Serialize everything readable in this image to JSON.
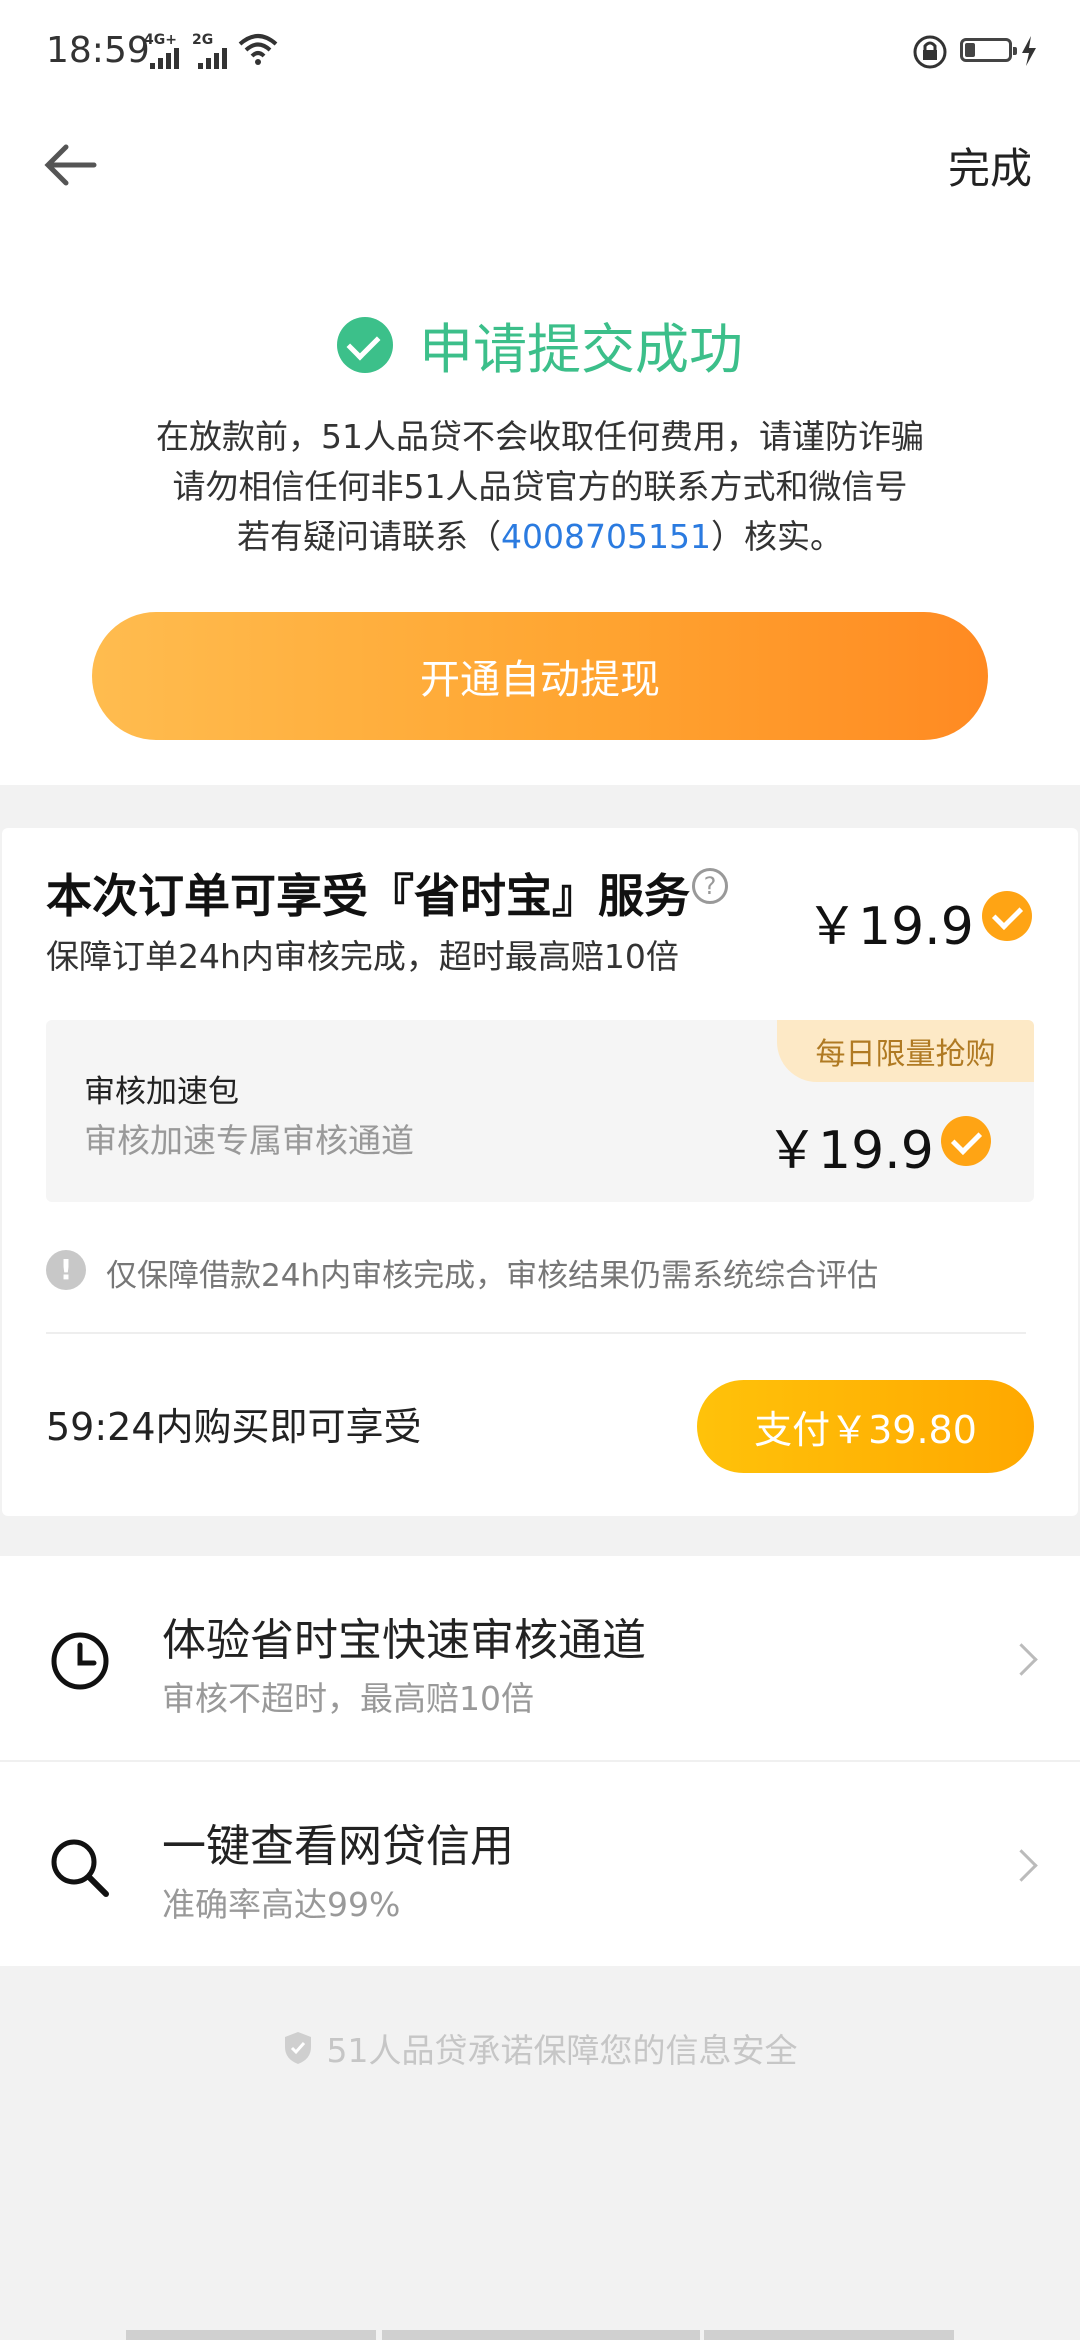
{
  "status_bar": {
    "time": "18:59",
    "net1": "4G+",
    "net2": "2G"
  },
  "header": {
    "done_label": "完成"
  },
  "success": {
    "title": "申请提交成功",
    "notice_line1": "在放款前，51人品贷不会收取任何费用，请谨防诈骗",
    "notice_line2": "请勿相信任何非51人品贷官方的联系方式和微信号",
    "notice_line3_prefix": "若有疑问请联系（",
    "phone": "4008705151",
    "notice_line3_suffix": "）核实。",
    "auto_withdraw_label": "开通自动提现"
  },
  "service_card": {
    "title": "本次订单可享受『省时宝』服务",
    "help_icon": "?",
    "subtitle": "保障订单24h内审核完成，超时最高赔10倍",
    "price": "￥19.9",
    "package": {
      "badge": "每日限量抢购",
      "title": "审核加速包",
      "subtitle": "审核加速专属审核通道",
      "price": "￥19.9"
    },
    "warning_icon": "!",
    "warning": "仅保障借款24h内审核完成，审核结果仍需系统综合评估",
    "countdown": "59:24内购买即可享受",
    "pay_label": "支付￥39.80"
  },
  "list": {
    "items": [
      {
        "title": "体验省时宝快速审核通道",
        "subtitle": "审核不超时，最高赔10倍",
        "icon": "clock-icon"
      },
      {
        "title": "一键查看网贷信用",
        "subtitle": "准确率高达99%",
        "icon": "search-icon"
      }
    ]
  },
  "footer": {
    "security_note": "51人品贷承诺保障您的信息安全"
  },
  "colors": {
    "success_green": "#3cbf8a",
    "link_blue": "#2b7be0",
    "orange_start": "#ffbc4f",
    "orange_end": "#ff8a22",
    "check_orange": "#ffa414",
    "pay_yellow": "#ffc20a"
  }
}
